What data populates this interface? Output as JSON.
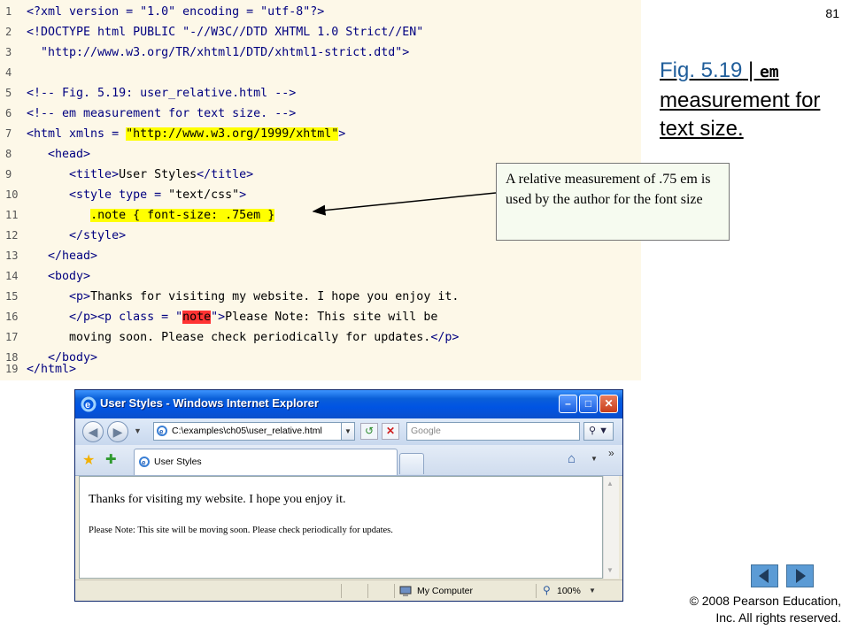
{
  "slide": {
    "page_number": "81",
    "title_fig": "Fig. 5.19",
    "title_sep": " | ",
    "title_code": "em",
    "title_rest": "measurement for text size.",
    "callout": "A relative measurement of .75 em is used by the author for the font size",
    "copyright_line1": "© 2008 Pearson Education,",
    "copyright_line2": "Inc.  All rights reserved."
  },
  "code": {
    "line_numbers": [
      "1",
      "2",
      "3",
      "4",
      "5",
      "6",
      "7",
      "8",
      "9",
      "10",
      "11",
      "12",
      "13",
      "14",
      "15",
      "16",
      "17",
      "18",
      "19"
    ],
    "l1": [
      "<?xml version = \"1.0\" encoding = \"utf-8\"?>"
    ],
    "l2": [
      "<!DOCTYPE html PUBLIC \"-//W3C//DTD XHTML 1.0 Strict//EN\""
    ],
    "l3": [
      "  \"http://www.w3.org/TR/xhtml1/DTD/xhtml1-strict.dtd\">"
    ],
    "l5": [
      "<!-- Fig. 5.19: user_relative.html -->"
    ],
    "l6": [
      "<!-- em measurement for text size. -->"
    ],
    "l7": [
      "<html xmlns = ",
      "\"http://www.w3.org/1999/xhtml\"",
      ">"
    ],
    "l8": [
      "   <head>"
    ],
    "l9": [
      "      <title>",
      "User Styles",
      "</title>"
    ],
    "l10": [
      "      <style type = ",
      "\"text/css\"",
      ">"
    ],
    "l11": [
      "         ",
      ".note { font-size: .75em }"
    ],
    "l12": [
      "      </style>"
    ],
    "l13": [
      "   </head>"
    ],
    "l14": [
      "   <body>"
    ],
    "l15": [
      "      <p>",
      "Thanks for visiting my website. I hope you enjoy it."
    ],
    "l16": [
      "      </p><p class = \"",
      "note",
      "\">",
      "Please Note: This site will be"
    ],
    "l17": [
      "      moving soon. Please check periodically for updates.",
      "</p>"
    ],
    "l18": [
      "   </body>"
    ],
    "l19": [
      "</html>"
    ]
  },
  "browser": {
    "window_title": "User Styles - Windows Internet Explorer",
    "min_glyph": "–",
    "max_glyph": "□",
    "close_glyph": "✕",
    "address": "C:\\examples\\ch05\\user_relative.html",
    "search_placeholder": "Google",
    "tab_label": "User Styles",
    "content_p1": "Thanks for visiting my website. I hope you enjoy it.",
    "content_p2": "Please Note: This site will be moving soon. Please check periodically for updates.",
    "status_zone": "My Computer",
    "zoom": "100%",
    "more_glyph": "»"
  },
  "colors": {
    "code_background": "#fdf8e8",
    "highlight_yellow": "#ffff00",
    "highlight_red": "#ff3333",
    "title_link": "#1f5d9a",
    "ie_titlebar": "#0054e3",
    "nav_button": "#5b9bd5"
  }
}
